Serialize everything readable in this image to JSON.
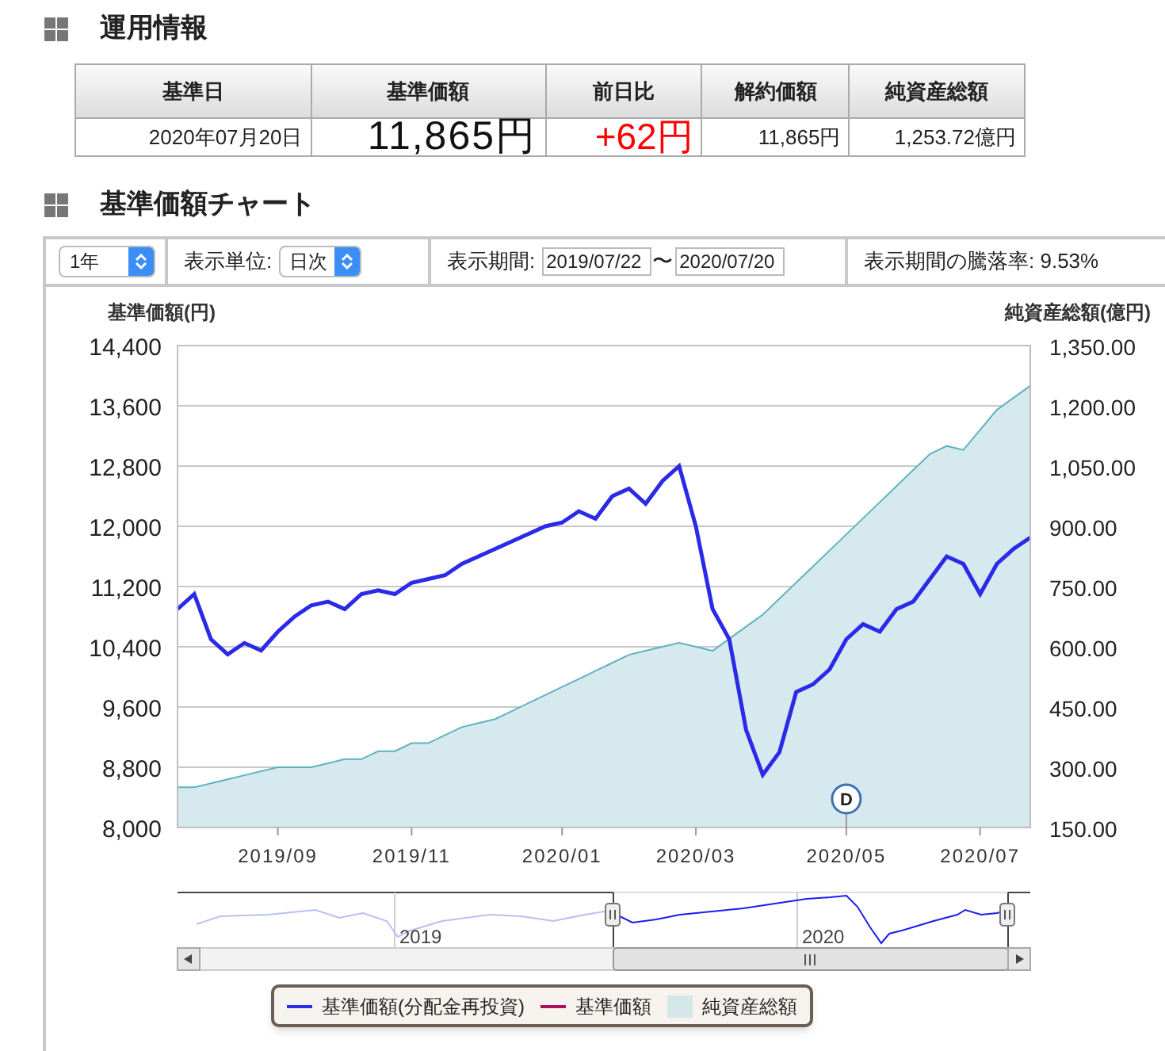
{
  "sections": [
    {
      "title": "運用情報"
    },
    {
      "title": "基準価額チャート"
    }
  ],
  "summary_table": {
    "columns": [
      "基準日",
      "基準価額",
      "前日比",
      "解約価額",
      "純資産総額"
    ],
    "row": [
      {
        "text": "2020年07月20日",
        "kind": "date"
      },
      {
        "text": "11,865円",
        "kind": "big"
      },
      {
        "text": "+62円",
        "kind": "change"
      },
      {
        "text": "11,865円",
        "kind": "plain"
      },
      {
        "text": "1,253.72億円",
        "kind": "plain"
      }
    ]
  },
  "toolbar": {
    "range_select": {
      "value": "1年"
    },
    "unit_label": "表示単位:",
    "unit_select": {
      "value": "日次"
    },
    "period_label": "表示期間:",
    "period_from": "2019/07/22",
    "period_sep": "〜",
    "period_to": "2020/07/20",
    "change_label": "表示期間の騰落率: 9.53%"
  },
  "chart_data": {
    "type": "line",
    "ylabel": "基準価額(円)",
    "y2label": "純資産総額(億円)",
    "ylim": [
      8000,
      14400
    ],
    "y2lim": [
      150,
      1350
    ],
    "grid": true,
    "categories": [
      null,
      null,
      null,
      null,
      null,
      null,
      "2019/09",
      null,
      null,
      null,
      null,
      null,
      null,
      null,
      "2019/11",
      null,
      null,
      null,
      null,
      null,
      null,
      null,
      null,
      "2020/01",
      null,
      null,
      null,
      null,
      null,
      null,
      null,
      "2020/03",
      null,
      null,
      null,
      null,
      null,
      null,
      null,
      null,
      "2020/05",
      null,
      null,
      null,
      null,
      null,
      null,
      null,
      "2020/07",
      null,
      null,
      null
    ],
    "yticks": [
      {
        "value": 8000,
        "label": "8,000"
      },
      {
        "value": 8800,
        "label": "8,800"
      },
      {
        "value": 9600,
        "label": "9,600"
      },
      {
        "value": 10400,
        "label": "10,400"
      },
      {
        "value": 11200,
        "label": "11,200"
      },
      {
        "value": 12000,
        "label": "12,000"
      },
      {
        "value": 12800,
        "label": "12,800"
      },
      {
        "value": 13600,
        "label": "13,600"
      },
      {
        "value": 14400,
        "label": "14,400"
      }
    ],
    "y2ticks": [
      {
        "value": 150,
        "label": "150.00"
      },
      {
        "value": 300,
        "label": "300.00"
      },
      {
        "value": 450,
        "label": "450.00"
      },
      {
        "value": 600,
        "label": "600.00"
      },
      {
        "value": 750,
        "label": "750.00"
      },
      {
        "value": 900,
        "label": "900.00"
      },
      {
        "value": 1050,
        "label": "1,050.00"
      },
      {
        "value": 1200,
        "label": "1,200.00"
      },
      {
        "value": 1350,
        "label": "1,350.00"
      }
    ],
    "series": [
      {
        "name": "基準価額(分配金再投資)",
        "color": "#2a2ae8",
        "values": [
          10900,
          11100,
          10500,
          10300,
          10450,
          10350,
          10600,
          10800,
          10950,
          11000,
          10900,
          11100,
          11150,
          11100,
          11250,
          11300,
          11350,
          11500,
          11600,
          11700,
          11800,
          11900,
          12000,
          12050,
          12200,
          12100,
          12400,
          12500,
          12300,
          12600,
          12800,
          12000,
          10900,
          10500,
          9300,
          8700,
          9000,
          9800,
          9900,
          10100,
          10500,
          10700,
          10600,
          10900,
          11000,
          11300,
          11600,
          11500,
          11100,
          11500,
          11700,
          11850
        ]
      },
      {
        "name": "基準価額",
        "color": "#b0105a",
        "values": [
          null,
          null,
          null,
          null,
          null,
          null,
          null,
          null,
          null,
          null,
          null,
          null,
          null,
          null,
          null,
          null,
          null,
          null,
          null,
          null,
          null,
          null,
          null,
          null,
          null,
          null,
          null,
          null,
          null,
          null,
          null,
          null,
          null,
          null,
          null,
          null,
          null,
          null,
          null,
          null,
          null,
          null,
          null,
          null,
          null,
          null,
          null,
          null,
          null,
          null,
          null,
          null
        ]
      },
      {
        "name": "純資産総額",
        "color": "#5fb3bf",
        "type": "area",
        "axis": "y2",
        "values": [
          250,
          250,
          260,
          270,
          280,
          290,
          300,
          300,
          300,
          310,
          320,
          320,
          340,
          340,
          360,
          360,
          380,
          400,
          410,
          420,
          440,
          460,
          480,
          500,
          520,
          540,
          560,
          580,
          590,
          600,
          610,
          600,
          590,
          620,
          650,
          680,
          720,
          760,
          800,
          840,
          880,
          920,
          960,
          1000,
          1040,
          1080,
          1100,
          1090,
          1140,
          1190,
          1220,
          1250
        ]
      }
    ],
    "annotations": [
      {
        "text": "D",
        "x": "2020/05"
      }
    ]
  },
  "navigator": {
    "labels": [
      "2019",
      "2020"
    ]
  }
}
